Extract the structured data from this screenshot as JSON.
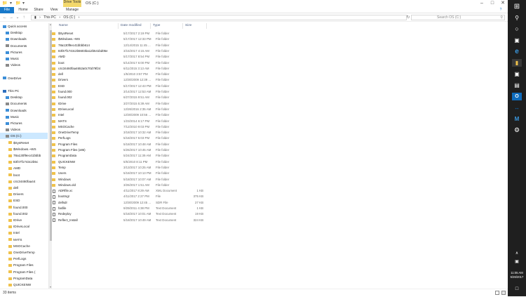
{
  "window": {
    "title": "OS (C:)",
    "context_tab": "Drive Tools"
  },
  "ribbon": {
    "tabs": [
      "File",
      "Home",
      "Share",
      "View",
      "Manage"
    ]
  },
  "address": {
    "path": [
      "This PC",
      "OS (C:)"
    ],
    "search_placeholder": "Search OS (C:)"
  },
  "nav": [
    {
      "label": "Quick access",
      "icon": "star-icon",
      "indent": 0
    },
    {
      "label": "Desktop",
      "icon": "desktop-icon",
      "indent": 1
    },
    {
      "label": "Downloads",
      "icon": "download-icon",
      "indent": 1
    },
    {
      "label": "Documents",
      "icon": "documents-icon",
      "indent": 1
    },
    {
      "label": "Pictures",
      "icon": "pictures-icon",
      "indent": 1
    },
    {
      "label": "Music",
      "icon": "music-icon",
      "indent": 1
    },
    {
      "label": "Videos",
      "icon": "videos-icon",
      "indent": 1
    },
    {
      "label": "",
      "icon": "",
      "indent": 0
    },
    {
      "label": "OneDrive",
      "icon": "onedrive-icon",
      "indent": 0
    },
    {
      "label": "",
      "icon": "",
      "indent": 0
    },
    {
      "label": "This PC",
      "icon": "pc-icon",
      "indent": 0
    },
    {
      "label": "Desktop",
      "icon": "desktop-icon",
      "indent": 1
    },
    {
      "label": "Documents",
      "icon": "documents-icon",
      "indent": 1
    },
    {
      "label": "Downloads",
      "icon": "download-icon",
      "indent": 1
    },
    {
      "label": "Music",
      "icon": "music-icon",
      "indent": 1
    },
    {
      "label": "Pictures",
      "icon": "pictures-icon",
      "indent": 1
    },
    {
      "label": "Videos",
      "icon": "videos-icon",
      "indent": 1
    },
    {
      "label": "OS (C:)",
      "icon": "drive-icon",
      "indent": 1,
      "selected": true
    },
    {
      "label": "$SysReset",
      "icon": "folder-icon",
      "indent": 2
    },
    {
      "label": "$Windows.~WS",
      "icon": "folder-icon",
      "indent": 2
    },
    {
      "label": "78a130f9ec41bbbb",
      "icon": "folder-icon",
      "indent": 2
    },
    {
      "label": "83f47f1743c2b5c",
      "icon": "folder-icon",
      "indent": 2
    },
    {
      "label": "AMD",
      "icon": "folder-icon",
      "indent": 2
    },
    {
      "label": "boot",
      "icon": "folder-icon",
      "indent": 2
    },
    {
      "label": "c4c34460faa44",
      "icon": "folder-icon",
      "indent": 2
    },
    {
      "label": "dell",
      "icon": "folder-icon",
      "indent": 2
    },
    {
      "label": "Drivers",
      "icon": "folder-icon",
      "indent": 2
    },
    {
      "label": "ESD",
      "icon": "folder-icon",
      "indent": 2
    },
    {
      "label": "found.000",
      "icon": "folder-icon",
      "indent": 2
    },
    {
      "label": "found.002",
      "icon": "folder-icon",
      "indent": 2
    },
    {
      "label": "IDrive",
      "icon": "folder-icon",
      "indent": 2
    },
    {
      "label": "IDriveLocal",
      "icon": "folder-icon",
      "indent": 2
    },
    {
      "label": "Intel",
      "icon": "folder-icon",
      "indent": 2
    },
    {
      "label": "MATS",
      "icon": "folder-icon",
      "indent": 2
    },
    {
      "label": "MSOCache",
      "icon": "folder-icon",
      "indent": 2
    },
    {
      "label": "OneDriveTemp",
      "icon": "folder-icon",
      "indent": 2
    },
    {
      "label": "PerfLogs",
      "icon": "folder-icon",
      "indent": 2
    },
    {
      "label": "Program Files",
      "icon": "folder-icon",
      "indent": 2
    },
    {
      "label": "Program Files (",
      "icon": "folder-icon",
      "indent": 2
    },
    {
      "label": "ProgramData",
      "icon": "folder-icon",
      "indent": 2
    },
    {
      "label": "QUICKENW",
      "icon": "folder-icon",
      "indent": 2
    }
  ],
  "columns": [
    "Name",
    "Date modified",
    "Type",
    "Size"
  ],
  "files": [
    {
      "name": "$SysReset",
      "date": "5/17/2017 2:19 PM",
      "type": "File folder",
      "size": "",
      "kind": "folder"
    },
    {
      "name": "$Windows.~WS",
      "date": "5/17/2017 12:33 PM",
      "type": "File folder",
      "size": "",
      "kind": "folder"
    },
    {
      "name": "78a130f9ec41bbbb614",
      "date": "12/14/2015 11:45 ...",
      "type": "File folder",
      "size": "",
      "kind": "folder"
    },
    {
      "name": "83f47f1743c2b5603ba12b541bd05e",
      "date": "3/15/2017 4:15 AM",
      "type": "File folder",
      "size": "",
      "kind": "folder"
    },
    {
      "name": "AMD",
      "date": "5/17/2017 8:54 PM",
      "type": "File folder",
      "size": "",
      "kind": "folder"
    },
    {
      "name": "boot",
      "date": "5/14/2017 6:00 PM",
      "type": "File folder",
      "size": "",
      "kind": "folder"
    },
    {
      "name": "c4c34460faa4652a0c70d79f24",
      "date": "6/11/2015 3:13 AM",
      "type": "File folder",
      "size": "",
      "kind": "folder"
    },
    {
      "name": "dell",
      "date": "1/5/2010 3:57 PM",
      "type": "File folder",
      "size": "",
      "kind": "folder"
    },
    {
      "name": "Drivers",
      "date": "12/30/2009 12:39 ...",
      "type": "File folder",
      "size": "",
      "kind": "folder"
    },
    {
      "name": "ESD",
      "date": "5/17/2017 12:43 PM",
      "type": "File folder",
      "size": "",
      "kind": "folder"
    },
    {
      "name": "found.000",
      "date": "3/14/2017 12:53 AM",
      "type": "File folder",
      "size": "",
      "kind": "folder"
    },
    {
      "name": "found.002",
      "date": "6/27/2015 9:51 AM",
      "type": "File folder",
      "size": "",
      "kind": "folder"
    },
    {
      "name": "IDrive",
      "date": "3/27/2015 5:39 AM",
      "type": "File folder",
      "size": "",
      "kind": "folder"
    },
    {
      "name": "IDriveLocal",
      "date": "12/26/2016 2:35 AM",
      "type": "File folder",
      "size": "",
      "kind": "folder"
    },
    {
      "name": "Intel",
      "date": "12/30/2009 10:56 ...",
      "type": "File folder",
      "size": "",
      "kind": "folder"
    },
    {
      "name": "MATS",
      "date": "1/23/2014 6:17 PM",
      "type": "File folder",
      "size": "",
      "kind": "folder"
    },
    {
      "name": "MSOCache",
      "date": "7/12/2010 9:03 PM",
      "type": "File folder",
      "size": "",
      "kind": "folder"
    },
    {
      "name": "OneDriveTemp",
      "date": "3/18/2017 10:32 AM",
      "type": "File folder",
      "size": "",
      "kind": "folder"
    },
    {
      "name": "PerfLogs",
      "date": "5/18/2017 5:03 PM",
      "type": "File folder",
      "size": "",
      "kind": "folder"
    },
    {
      "name": "Program Files",
      "date": "5/18/2017 10:48 AM",
      "type": "File folder",
      "size": "",
      "kind": "folder"
    },
    {
      "name": "Program Files (x86)",
      "date": "5/26/2017 10:45 AM",
      "type": "File folder",
      "size": "",
      "kind": "folder"
    },
    {
      "name": "ProgramData",
      "date": "5/24/2017 11:39 AM",
      "type": "File folder",
      "size": "",
      "kind": "folder"
    },
    {
      "name": "QUICKENW",
      "date": "5/5/2010 8:11 PM",
      "type": "File folder",
      "size": "",
      "kind": "folder"
    },
    {
      "name": "Temp",
      "date": "3/13/2017 10:25 AM",
      "type": "File folder",
      "size": "",
      "kind": "folder"
    },
    {
      "name": "Users",
      "date": "5/18/2017 10:13 PM",
      "type": "File folder",
      "size": "",
      "kind": "folder"
    },
    {
      "name": "Windows",
      "date": "5/18/2017 10:07 AM",
      "type": "File folder",
      "size": "",
      "kind": "folder"
    },
    {
      "name": "Windows.old",
      "date": "3/26/2017 1:51 AM",
      "type": "File folder",
      "size": "",
      "kind": "folder"
    },
    {
      "name": "ADRfile.xc",
      "date": "4/11/2017 8:29 AM",
      "type": "XML Document",
      "size": "1 KB",
      "kind": "doc"
    },
    {
      "name": "bootmgr",
      "date": "4/11/2017 2:27 PM",
      "type": "File",
      "size": "375 KB",
      "kind": "doc"
    },
    {
      "name": "dellsdr",
      "date": "12/30/2009 12:45 ...",
      "type": "SDR File",
      "size": "27 KB",
      "kind": "doc"
    },
    {
      "name": "fasfile",
      "date": "9/29/2011 4:38 PM",
      "type": "Text Document",
      "size": "1 KB",
      "kind": "doc"
    },
    {
      "name": "Redeploy",
      "date": "5/18/2017 10:01 AM",
      "type": "Text Document",
      "size": "19 KB",
      "kind": "doc"
    },
    {
      "name": "Reflect_Install",
      "date": "5/18/2017 10:49 AM",
      "type": "Text Document",
      "size": "324 KB",
      "kind": "doc"
    }
  ],
  "status": {
    "items": "33 items"
  },
  "taskbar": {
    "time": "11:05 AM",
    "date": "5/26/2017"
  }
}
